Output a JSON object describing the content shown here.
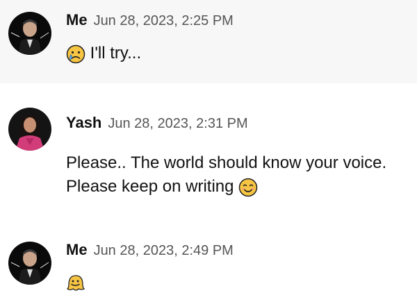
{
  "messages": [
    {
      "author": "Me",
      "timestamp": "Jun 28, 2023, 2:25 PM",
      "emoji": "crying-face-icon",
      "lines": [
        "I'll try..."
      ]
    },
    {
      "author": "Yash",
      "timestamp": "Jun 28, 2023, 2:31 PM",
      "lines": [
        "Please.. The world should know your voice.",
        "Please keep on writing"
      ],
      "emoji": "smiling-face-icon"
    },
    {
      "author": "Me",
      "timestamp": "Jun 28, 2023, 2:49 PM",
      "emoji": "melting-face-icon",
      "lines": []
    }
  ],
  "colors": {
    "author": "#111111",
    "timestamp": "#555555",
    "highlight_bg": "#f7f7f7",
    "emoji_yellow": "#f7c544"
  }
}
